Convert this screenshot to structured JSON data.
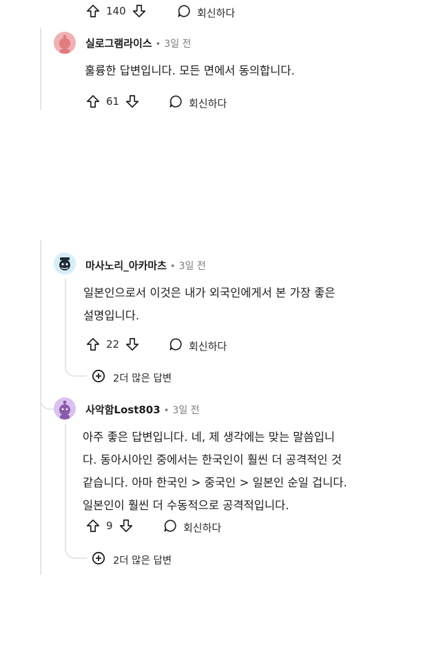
{
  "reply_label": "회신하다",
  "comments": [
    {
      "score": "140"
    },
    {
      "username": "실로그램라이스",
      "separator": "•",
      "age": "3일 전",
      "lines": [
        "훌륭한 답변입니다. 모든 면에서 동의합니다."
      ],
      "score": "61"
    },
    {
      "username": "마사노리_아카마츠",
      "separator": "•",
      "age": "3일 전",
      "lines": [
        "일본인으로서 이것은 내가 외국인에게서 본 가장 좋은",
        "설명입니다."
      ],
      "score": "22",
      "more_replies": "2더 많은 답변"
    },
    {
      "username": "사악함Lost803",
      "separator": "•",
      "age": "3일 전",
      "lines": [
        "아주 좋은 답변입니다. 네, 제 생각에는 맞는 말씀입니",
        "다. 동아시아인 중에서는 한국인이 훨씬 더 공격적인 것",
        "같습니다. 아마 한국인 > 중국인 > 일본인 순일 겁니다.",
        "일본인이 훨씬 더 수동적으로 공격적입니다."
      ],
      "score": "9",
      "more_replies": "2더 많은 답변"
    }
  ],
  "colors": {
    "avatar_1": "#f0b0b4",
    "avatar_2": "#d7eef9",
    "avatar_3": "#d9c2ef"
  },
  "icons": [
    "upvote-icon",
    "downvote-icon",
    "comment-bubble-icon",
    "plus-circle-icon"
  ]
}
